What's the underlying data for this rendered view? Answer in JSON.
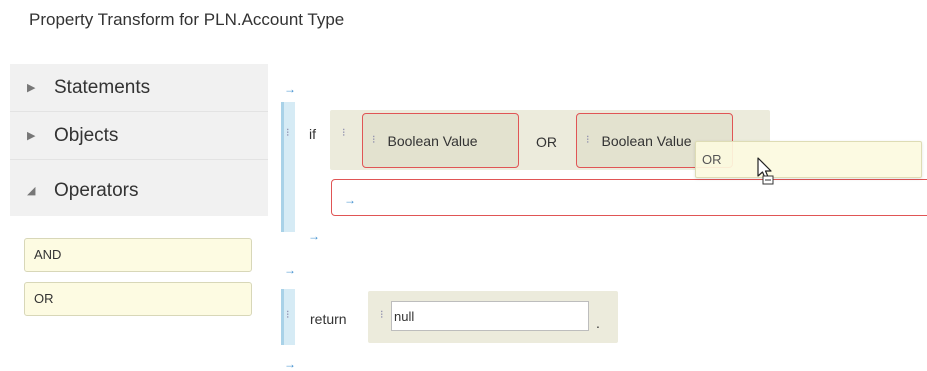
{
  "title": "Property Transform for PLN.Account Type",
  "palette": {
    "categories": [
      {
        "label": "Statements",
        "caret": "▶",
        "state": "collapsed"
      },
      {
        "label": "Objects",
        "caret": "▶",
        "state": "collapsed"
      },
      {
        "label": "Operators",
        "caret": "◢",
        "state": "expanded"
      }
    ],
    "operators": [
      "AND",
      "OR"
    ]
  },
  "canvas": {
    "drop_arrow": "→",
    "grip": "⁝",
    "if_keyword": "if",
    "left_operand": "Boolean Value",
    "operator": "OR",
    "right_operand": "Boolean Value",
    "drag_ghost_label": "OR",
    "return_keyword": "return",
    "return_value": "null",
    "statement_terminator": "."
  },
  "colors": {
    "accent_arrow": "#3f8fcf",
    "slot_error_border": "#e05555",
    "block_background": "#ecebdc",
    "operator_item_background": "#fdfbe2",
    "palette_background": "#f1f1f1"
  }
}
